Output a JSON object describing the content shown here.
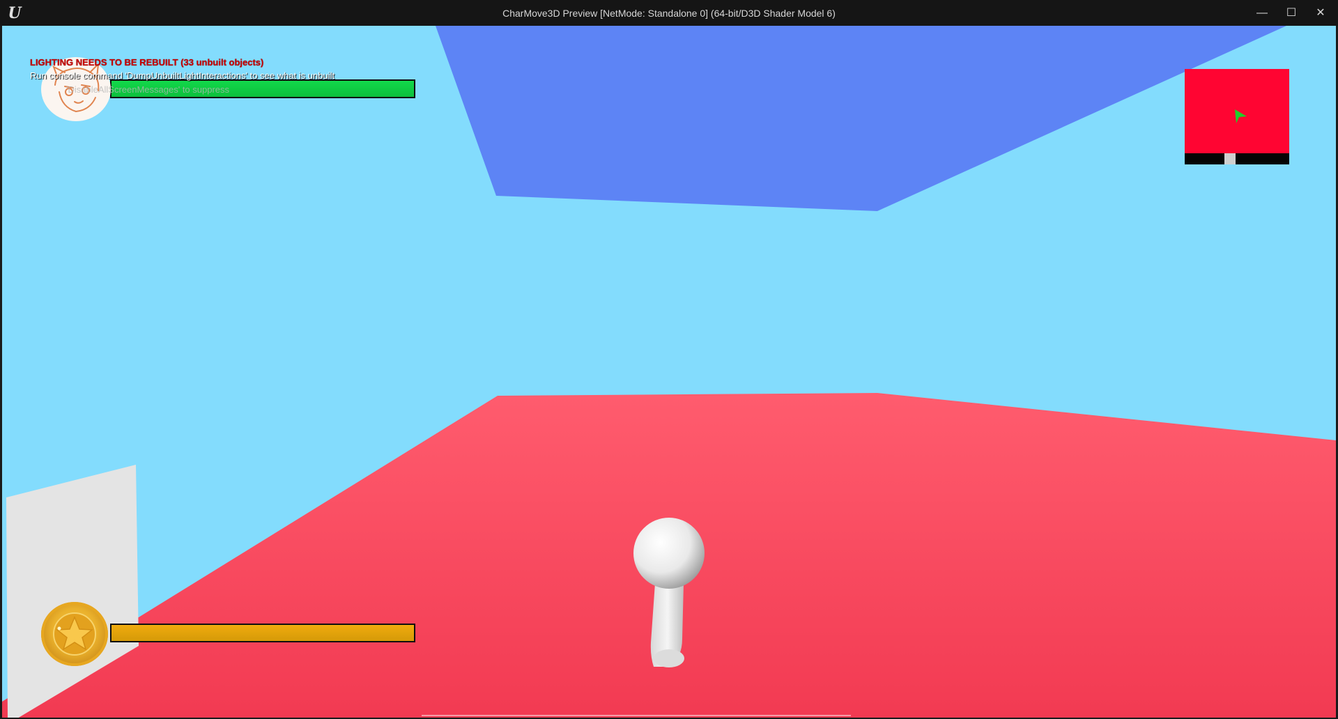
{
  "window": {
    "title": "CharMove3D Preview [NetMode: Standalone 0]  (64-bit/D3D Shader Model 6)",
    "logo_glyph": "U",
    "minimize_glyph": "—",
    "maximize_glyph": "☐",
    "close_glyph": "✕"
  },
  "messages": {
    "warning": "LIGHTING NEEDS TO BE REBUILT (33 unbuilt objects)",
    "info": "Run console command 'DumpUnbuiltLightInteractions' to see what is unbuilt",
    "suppress": "'DisableAllScreenMessages' to suppress"
  },
  "hud": {
    "health": {
      "level": 1.0,
      "color": "#10d446",
      "icon": "character-portrait-icon"
    },
    "coins": {
      "level": 1.0,
      "color": "#e8a60c",
      "icon": "star-coin-icon"
    }
  },
  "minimap": {
    "background_color": "#ff0532",
    "player_marker_color": "#1ed02a",
    "player_marker_icon": "player-arrow-icon"
  },
  "scene": {
    "sky_color": "#83dcfd",
    "ceiling_color": "#5d84f5",
    "floor_color": "#ff4a5e",
    "wall_color": "#e4e4e4",
    "character_color": "#f2f2f2"
  }
}
